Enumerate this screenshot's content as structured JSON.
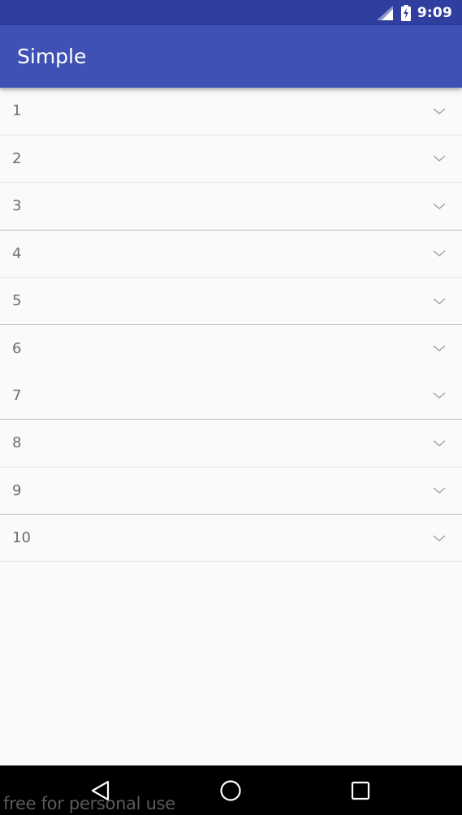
{
  "status_bar": {
    "time": "9:09",
    "icons": [
      "signal-icon",
      "battery-charging-icon"
    ],
    "background": "#303f9f"
  },
  "app_bar": {
    "title": "Simple",
    "background": "#3f51b5"
  },
  "list": {
    "items": [
      {
        "label": "1",
        "icon": "chevron-down-icon"
      },
      {
        "label": "2",
        "icon": "chevron-down-icon"
      },
      {
        "label": "3",
        "icon": "chevron-down-icon"
      },
      {
        "label": "4",
        "icon": "chevron-down-icon"
      },
      {
        "label": "5",
        "icon": "chevron-down-icon"
      },
      {
        "label": "6",
        "icon": "chevron-down-icon"
      },
      {
        "label": "7",
        "icon": "chevron-down-icon"
      },
      {
        "label": "8",
        "icon": "chevron-down-icon"
      },
      {
        "label": "9",
        "icon": "chevron-down-icon"
      },
      {
        "label": "10",
        "icon": "chevron-down-icon"
      }
    ]
  },
  "nav_bar": {
    "buttons": [
      "back-icon",
      "home-icon",
      "recents-icon"
    ],
    "background": "#000000"
  },
  "watermark": "free for personal use"
}
